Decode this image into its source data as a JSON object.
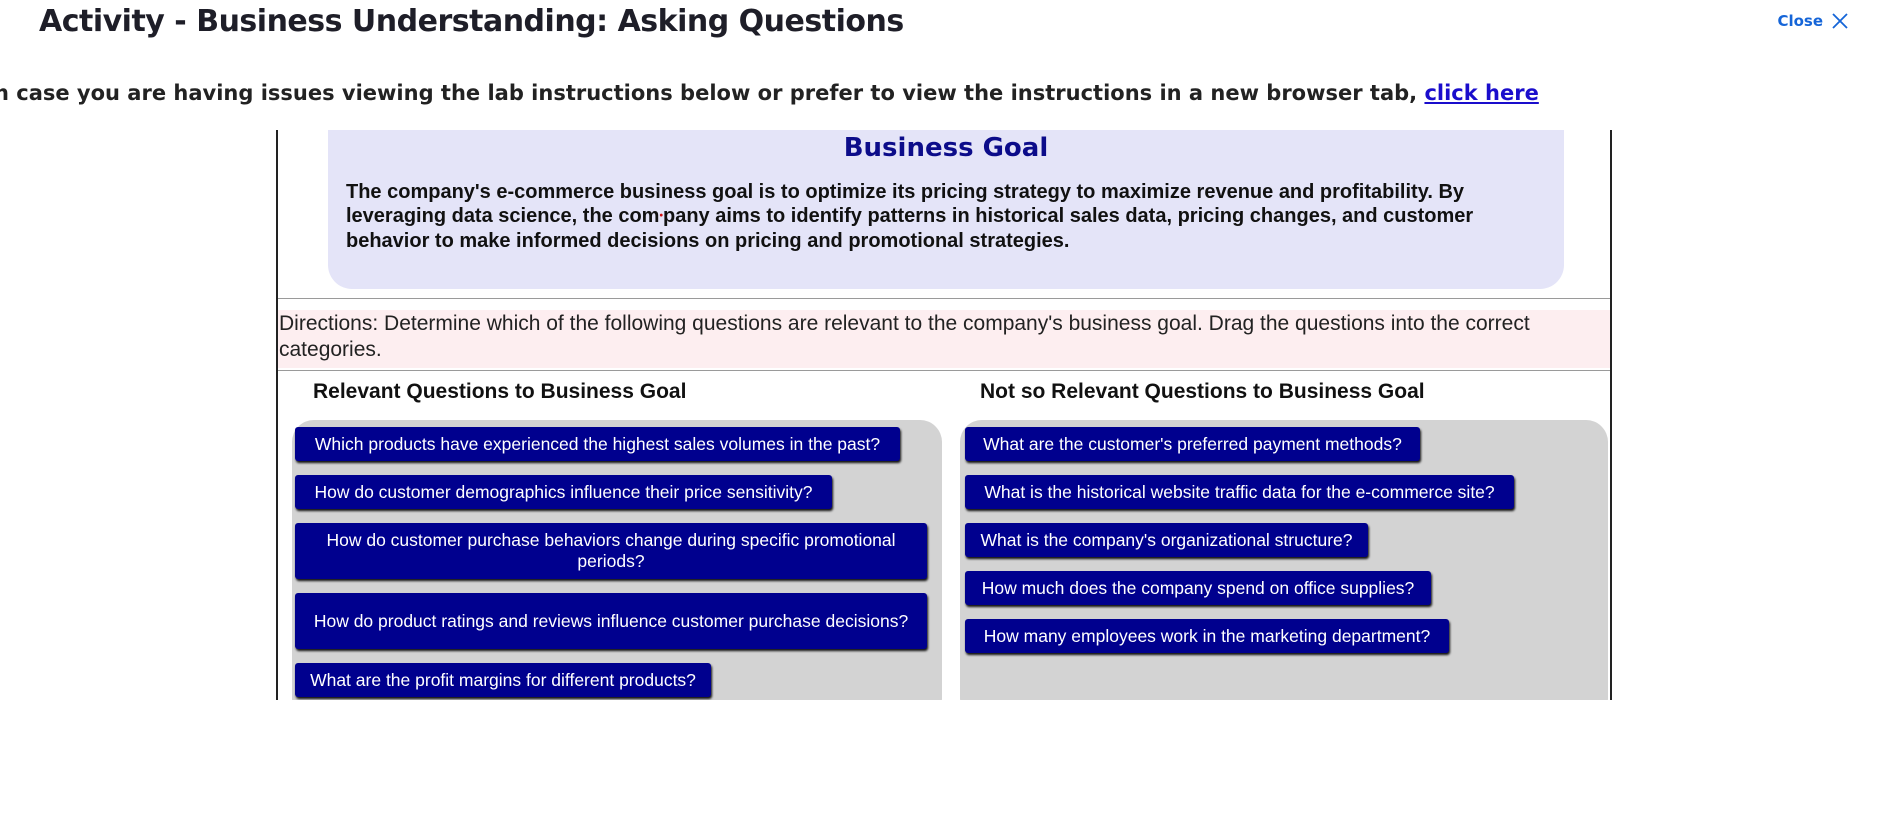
{
  "header": {
    "title": "Activity - Business Understanding: Asking Questions",
    "close_label": "Close",
    "close_icon": "close-icon"
  },
  "notice": {
    "text": "n case you are having issues viewing the lab instructions below or prefer to view the instructions in a new browser tab, ",
    "link_label": "click here"
  },
  "goal": {
    "title": "Business Goal",
    "text_part1": "The company's e-commerce business goal is to optimize its pricing strategy to maximize revenue and profitability. By leveraging data science, the com",
    "text_part2": "pany aims to identify patterns in historical sales data, pricing changes, and customer behavior to make informed decisions on pricing and promotional strategies."
  },
  "directions": "Directions: Determine which of the following questions are relevant to the company's business goal. Drag the questions into the correct categories.",
  "relevant": {
    "heading": "Relevant Questions to Business Goal",
    "questions": [
      "Which products have experienced the highest sales volumes in the past?",
      "How do customer demographics influence their price sensitivity?",
      "How do customer purchase behaviors change during specific promotional periods?",
      "How do product ratings and reviews influence customer purchase decisions?",
      "What are the profit margins for different products?"
    ]
  },
  "not_relevant": {
    "heading": "Not so Relevant Questions to Business Goal",
    "questions": [
      "What are the customer's preferred payment methods?",
      "What is the historical website traffic data for the e-commerce site?",
      "What is the company's organizational structure?",
      "How much does the company spend on office supplies?",
      "How many employees work in the marketing department?"
    ]
  },
  "colors": {
    "question_bg": "#00008E",
    "goal_bg": "#E4E4F8",
    "directions_bg": "#FDEEF0",
    "zone_bg": "#D3D3D3",
    "link": "#1A0DCC",
    "close": "#1565D8"
  }
}
